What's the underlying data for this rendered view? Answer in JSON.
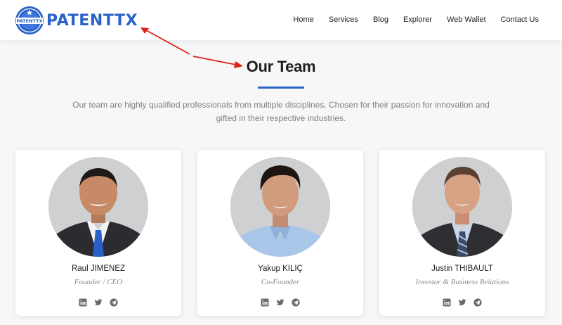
{
  "header": {
    "logo_text": "PATENTTX",
    "logo_badge_text": "PATENTTX",
    "nav": [
      "Home",
      "Services",
      "Blog",
      "Explorer",
      "Web Wallet",
      "Contact Us"
    ]
  },
  "section": {
    "title": "Our Team",
    "description": "Our team are highly qualified professionals from multiple disciplines. Chosen for their passion for innovation and gifted in their respective industries."
  },
  "team": [
    {
      "name": "Raul JIMENEZ",
      "role": "Founder / CEO",
      "socials": [
        "linkedin-icon",
        "twitter-icon",
        "telegram-icon"
      ]
    },
    {
      "name": "Yakup KILIÇ",
      "role": "Co-Founder",
      "socials": [
        "linkedin-icon",
        "twitter-icon",
        "telegram-icon"
      ]
    },
    {
      "name": "Justin THIBAULT",
      "role": "Investor & Business Relations",
      "socials": [
        "linkedin-icon",
        "twitter-icon",
        "telegram-icon"
      ]
    }
  ],
  "colors": {
    "brand": "#2a62c9",
    "annotation_arrow": "#e0201b",
    "page_background": "#f7f7f8"
  }
}
